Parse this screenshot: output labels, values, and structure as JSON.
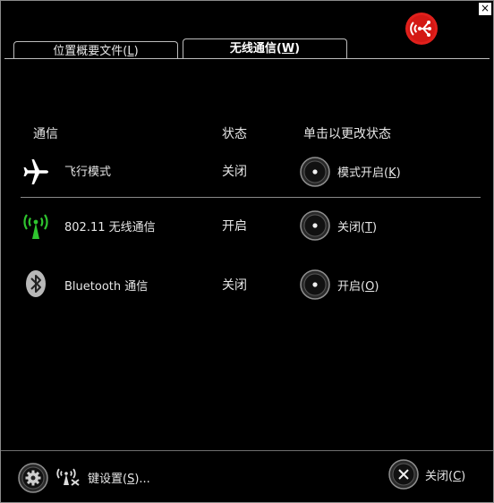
{
  "window": {
    "close_glyph": "×"
  },
  "tabs": [
    {
      "label": "位置概要文件(",
      "mnemonic": "L",
      "suffix": ")",
      "active": false
    },
    {
      "label": "无线通信(",
      "mnemonic": "W",
      "suffix": ")",
      "active": true
    }
  ],
  "headers": {
    "comm": "通信",
    "state": "状态",
    "action": "单击以更改状态"
  },
  "rows": [
    {
      "icon": "airplane-icon",
      "name": "飞行模式",
      "state": "关闭",
      "action_label": "模式开启(",
      "action_mnemonic": "K",
      "action_suffix": ")"
    },
    {
      "icon": "wifi-antenna-icon",
      "name": "802.11 无线通信",
      "state": "开启",
      "action_label": "关闭(",
      "action_mnemonic": "T",
      "action_suffix": ")"
    },
    {
      "icon": "bluetooth-icon",
      "name": "Bluetooth 通信",
      "state": "关闭",
      "action_label": "开启(",
      "action_mnemonic": "O",
      "action_suffix": ")"
    }
  ],
  "footer": {
    "settings_label": "键设置(",
    "settings_mnemonic": "S",
    "settings_suffix": ")...",
    "close_label": "关闭(",
    "close_mnemonic": "C",
    "close_suffix": ")"
  },
  "colors": {
    "accent_red": "#e0201c",
    "wifi_green": "#2fc52f",
    "bluetooth_gray": "#b8b8b8"
  }
}
